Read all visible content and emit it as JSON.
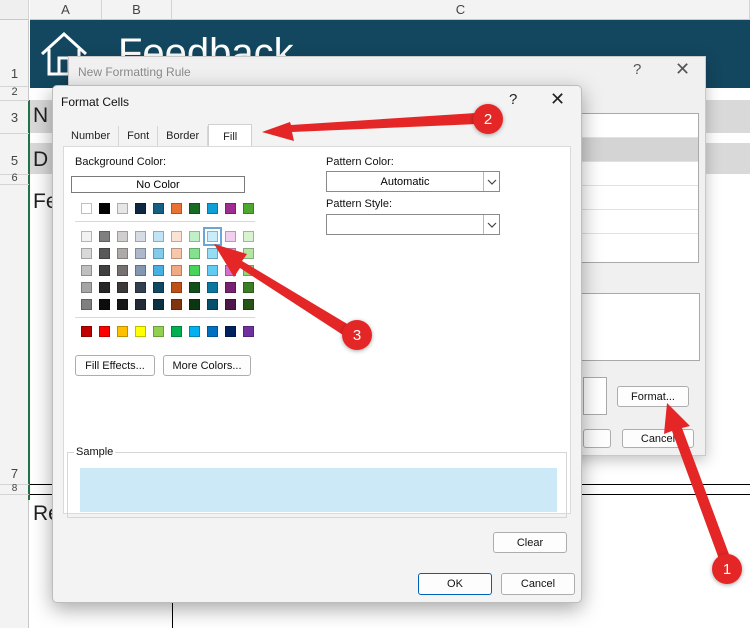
{
  "excel": {
    "columns": [
      "A",
      "B",
      "C"
    ],
    "rows": [
      "1",
      "2",
      "3",
      "5",
      "6",
      "7",
      "8"
    ],
    "banner_title": "Feedback",
    "cells": [
      "N",
      "D",
      "Fe",
      "Re"
    ]
  },
  "new_formatting_rule": {
    "title": "New Formatting Rule",
    "help": "?",
    "close": "✕",
    "format_button": "Format...",
    "cancel_button": "Cancel"
  },
  "format_cells": {
    "title": "Format Cells",
    "help": "?",
    "close": "✕",
    "tabs": [
      "Number",
      "Font",
      "Border",
      "Fill"
    ],
    "active_tab": "Fill",
    "background_color_label": "Background Color:",
    "no_color": "No Color",
    "pattern_color_label": "Pattern Color:",
    "pattern_color_value": "Automatic",
    "pattern_style_label": "Pattern Style:",
    "pattern_style_value": "",
    "fill_effects_button": "Fill Effects...",
    "more_colors_button": "More Colors...",
    "sample_label": "Sample",
    "sample_color": "#cbe9f6",
    "clear_button": "Clear",
    "ok_button": "OK",
    "cancel_button": "Cancel",
    "palette": {
      "theme_top": [
        "#ffffff",
        "#000000",
        "#e7e6e6",
        "#0e2841",
        "#156082",
        "#e97132",
        "#196b24",
        "#0f9ed5",
        "#a02b93",
        "#4ea72e"
      ],
      "theme_shades": [
        [
          "#f2f2f2",
          "#7f7f7f",
          "#d0cece",
          "#d6dce4",
          "#c0e4f5",
          "#fbe2d5",
          "#c1f0c8",
          "#caedfb",
          "#f2cfee",
          "#d9f2d0"
        ],
        [
          "#d9d9d9",
          "#595959",
          "#aeaaaa",
          "#adb9ca",
          "#83cbeb",
          "#f7c7ac",
          "#83e28e",
          "#95dcf7",
          "#e49edd",
          "#b4e5a2"
        ],
        [
          "#bfbfbf",
          "#404040",
          "#767171",
          "#8497b0",
          "#45b0e1",
          "#f1a983",
          "#47d45a",
          "#61cbf3",
          "#d86ecc",
          "#8ed973"
        ],
        [
          "#a6a6a6",
          "#262626",
          "#3a3838",
          "#323f4f",
          "#104862",
          "#c04f15",
          "#124f1a",
          "#0b76a0",
          "#782170",
          "#3b7d23"
        ],
        [
          "#808080",
          "#0d0d0d",
          "#171616",
          "#222a35",
          "#0a3041",
          "#80350e",
          "#0c3511",
          "#074f6a",
          "#501549",
          "#275317"
        ]
      ],
      "standard": [
        "#c00000",
        "#ff0000",
        "#ffc000",
        "#ffff00",
        "#92d050",
        "#00b050",
        "#00b0f0",
        "#0070c0",
        "#002060",
        "#7030a0"
      ],
      "selected": "#caedfb"
    }
  },
  "annotations": {
    "badges": [
      "1",
      "2",
      "3"
    ],
    "color": "#e52626"
  }
}
